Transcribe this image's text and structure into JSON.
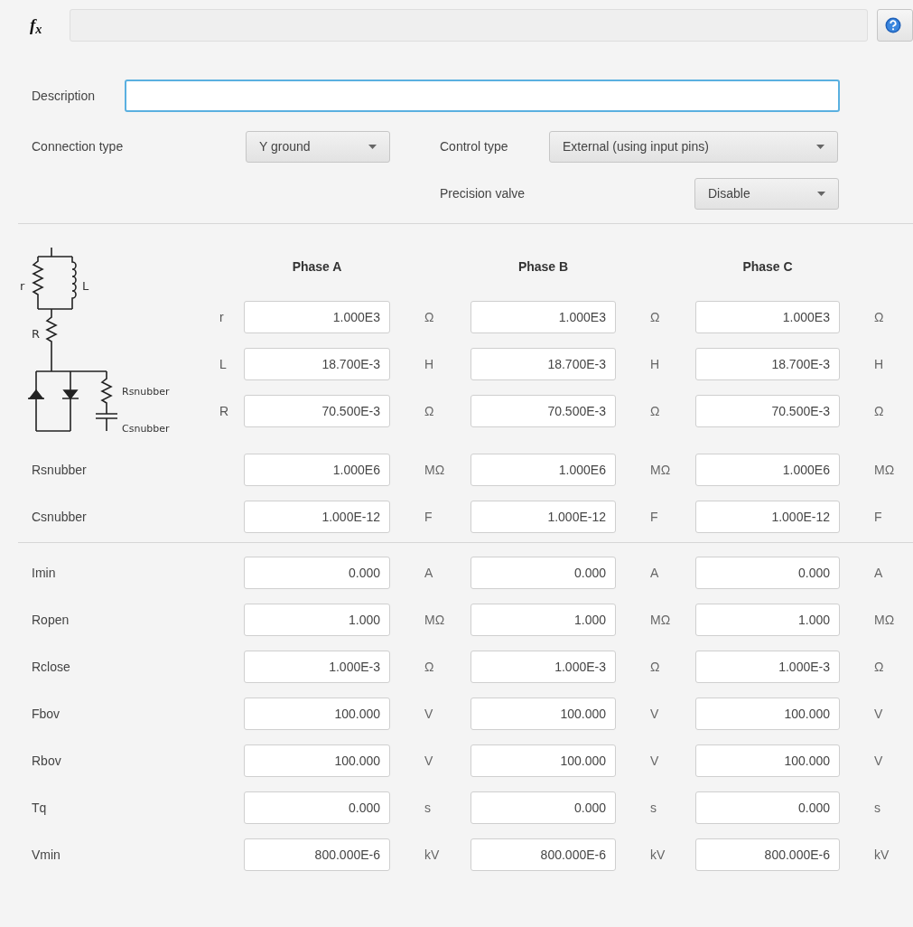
{
  "formula_bar": {
    "label": "f$_{x}$"
  },
  "description": {
    "label": "Description",
    "focused": true
  },
  "connection_type": {
    "label": "Connection type",
    "value": "Y ground"
  },
  "control_type": {
    "label": "Control type",
    "value": "External (using input pins)"
  },
  "precision_valve": {
    "label": "Precision valve",
    "value": "Disable"
  },
  "diagram_labels": [
    "r",
    "L",
    "R",
    "Rsnubber",
    "Csnubber"
  ],
  "phases": [
    "Phase A",
    "Phase B",
    "Phase C"
  ],
  "circuit_params": [
    {
      "label": "r",
      "cells": [
        {
          "value": "1.000E3",
          "unit": "Ω"
        },
        {
          "value": "1.000E3",
          "unit": "Ω"
        },
        {
          "value": "1.000E3",
          "unit": "Ω"
        }
      ]
    },
    {
      "label": "L",
      "cells": [
        {
          "value": "18.700E-3",
          "unit": "H"
        },
        {
          "value": "18.700E-3",
          "unit": "H"
        },
        {
          "value": "18.700E-3",
          "unit": "H"
        }
      ]
    },
    {
      "label": "R",
      "cells": [
        {
          "value": "70.500E-3",
          "unit": "Ω"
        },
        {
          "value": "70.500E-3",
          "unit": "Ω"
        },
        {
          "value": "70.500E-3",
          "unit": "Ω"
        }
      ]
    }
  ],
  "snubber_params": [
    {
      "label": "Rsnubber",
      "cells": [
        {
          "value": "1.000E6",
          "unit": "MΩ"
        },
        {
          "value": "1.000E6",
          "unit": "MΩ"
        },
        {
          "value": "1.000E6",
          "unit": "MΩ"
        }
      ]
    },
    {
      "label": "Csnubber",
      "cells": [
        {
          "value": "1.000E-12",
          "unit": "F"
        },
        {
          "value": "1.000E-12",
          "unit": "F"
        },
        {
          "value": "1.000E-12",
          "unit": "F"
        }
      ]
    }
  ],
  "thyristor_params": [
    {
      "label": "Imin",
      "cells": [
        {
          "value": "0.000",
          "unit": "A"
        },
        {
          "value": "0.000",
          "unit": "A"
        },
        {
          "value": "0.000",
          "unit": "A"
        }
      ]
    },
    {
      "label": "Ropen",
      "cells": [
        {
          "value": "1.000",
          "unit": "MΩ"
        },
        {
          "value": "1.000",
          "unit": "MΩ"
        },
        {
          "value": "1.000",
          "unit": "MΩ"
        }
      ]
    },
    {
      "label": "Rclose",
      "cells": [
        {
          "value": "1.000E-3",
          "unit": "Ω"
        },
        {
          "value": "1.000E-3",
          "unit": "Ω"
        },
        {
          "value": "1.000E-3",
          "unit": "Ω"
        }
      ]
    },
    {
      "label": "Fbov",
      "cells": [
        {
          "value": "100.000",
          "unit": "V"
        },
        {
          "value": "100.000",
          "unit": "V"
        },
        {
          "value": "100.000",
          "unit": "V"
        }
      ]
    },
    {
      "label": "Rbov",
      "cells": [
        {
          "value": "100.000",
          "unit": "V"
        },
        {
          "value": "100.000",
          "unit": "V"
        },
        {
          "value": "100.000",
          "unit": "V"
        }
      ]
    },
    {
      "label": "Tq",
      "cells": [
        {
          "value": "0.000",
          "unit": "s"
        },
        {
          "value": "0.000",
          "unit": "s"
        },
        {
          "value": "0.000",
          "unit": "s"
        }
      ]
    },
    {
      "label": "Vmin",
      "cells": [
        {
          "value": "800.000E-6",
          "unit": "kV"
        },
        {
          "value": "800.000E-6",
          "unit": "kV"
        },
        {
          "value": "800.000E-6",
          "unit": "kV"
        }
      ]
    }
  ]
}
